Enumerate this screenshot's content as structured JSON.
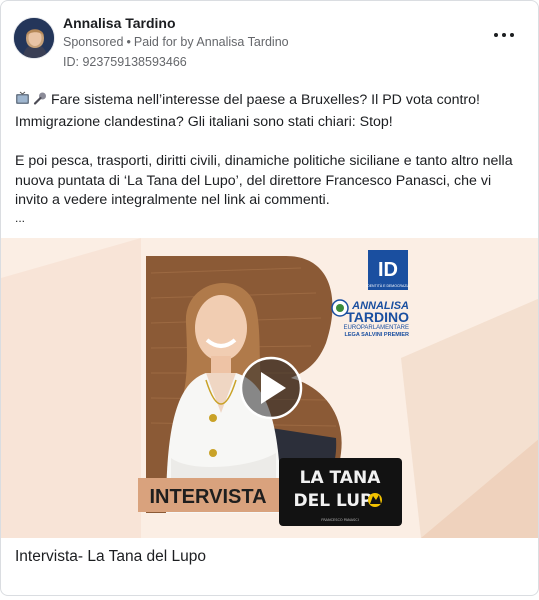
{
  "post": {
    "author_name": "Annalisa Tardino",
    "sponsored_label": "Sponsored",
    "separator": "•",
    "paid_for_label": "Paid for by",
    "payer_name": "Annalisa Tardino",
    "ad_id": "ID: 923759138593466",
    "paragraph1_line1": "Fare sistema nell’interesse del paese a Bruxelles? Il PD vota contro!",
    "paragraph1_line2": "Immigrazione clandestina? Gli italiani sono stati chiari: Stop!",
    "paragraph2": "E poi pesca, trasporti, diritti civili, dinamiche politiche siciliane e tanto altro nella nuova puntata di ‘La Tana del Lupo’, del direttore Francesco Panasci, che vi invito a vedere integralmente nel link ai commenti.",
    "ellipsis": "...",
    "caption": "Intervista- La Tana del Lupo"
  },
  "media": {
    "party_logo_text": "ID",
    "party_logo_subtext": "IDENTITÀ E DEMOCRAZIA",
    "candidate_first": "ANNALISA",
    "candidate_last": "TARDINO",
    "candidate_role": "EUROPARLAMENTARE",
    "candidate_party": "LEGA SALVINI PREMIER",
    "interview_label": "INTERVISTA",
    "show_title_line1": "LA TANA",
    "show_title_line2": "DEL LUP",
    "show_subtitle": "FRANCESCO PANASCI"
  },
  "icons": {
    "tv": "tv-icon",
    "mic": "microphone-icon",
    "more": "more-options-icon",
    "play": "play-icon"
  },
  "colors": {
    "accent_blue": "#1a4fa0",
    "letter_b_brown": "#8b5a36",
    "interview_bg": "#d9a27d"
  }
}
